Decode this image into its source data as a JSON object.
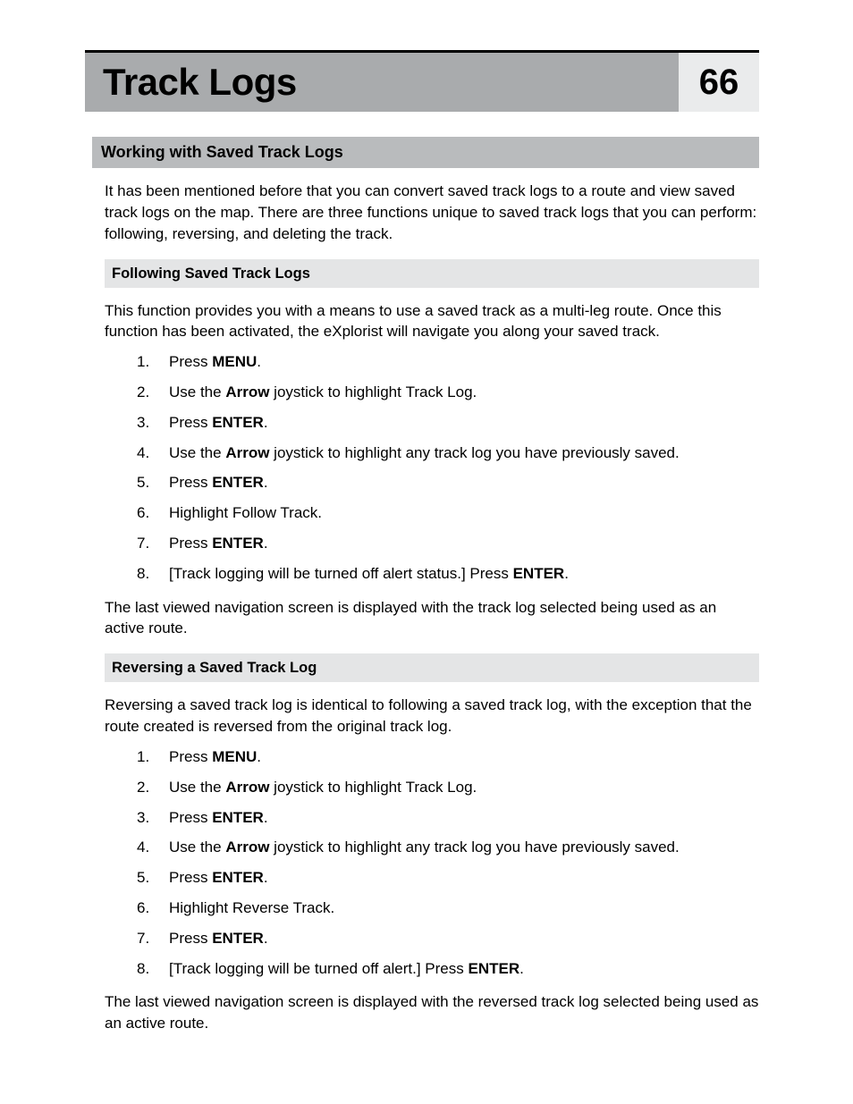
{
  "header": {
    "title": "Track Logs",
    "page": "66"
  },
  "section1": {
    "title": "Working with Saved Track Logs",
    "intro": "It has been mentioned before that you can convert saved track logs to a route and view saved track logs on the map.  There are three functions unique to saved track logs that you can perform: following, reversing, and deleting the track."
  },
  "subA": {
    "title": "Following Saved Track Logs",
    "intro": "This function provides you with a means to use a saved track as a multi-leg route.  Once this function has been activated, the eXplorist will navigate you along your saved track.",
    "steps": [
      {
        "n": "1.",
        "pre": "Press ",
        "b1": "MENU",
        "post": "."
      },
      {
        "n": "2.",
        "pre": "Use the ",
        "b1": "Arrow",
        "mid": " joystick to highlight ",
        "opt": "Track Log",
        "post": "."
      },
      {
        "n": "3.",
        "pre": "Press ",
        "b1": "ENTER",
        "post": "."
      },
      {
        "n": "4.",
        "pre": "Use the ",
        "b1": "Arrow",
        "mid": " joystick to highlight any track log you have previously saved.",
        "post": ""
      },
      {
        "n": "5.",
        "pre": "Press ",
        "b1": "ENTER",
        "post": "."
      },
      {
        "n": "6.",
        "pre": "Highlight ",
        "opt": "Follow Track",
        "post": "."
      },
      {
        "n": "7.",
        "pre": "Press ",
        "b1": "ENTER",
        "post": "."
      },
      {
        "n": "8.",
        "pre": "[Track logging will be turned off alert status.]  Press ",
        "b1": "ENTER",
        "post": "."
      }
    ],
    "outro": "The last viewed navigation screen is displayed with the track log selected being used as an active route."
  },
  "subB": {
    "title": "Reversing a Saved Track Log",
    "intro": "Reversing a saved track log is identical to following a saved track log, with the exception that the route created is reversed from the original track log.",
    "steps": [
      {
        "n": "1.",
        "pre": "Press ",
        "b1": "MENU",
        "post": "."
      },
      {
        "n": "2.",
        "pre": "Use the ",
        "b1": "Arrow",
        "mid": " joystick to highlight ",
        "opt": "Track Log",
        "post": "."
      },
      {
        "n": "3.",
        "pre": "Press ",
        "b1": "ENTER",
        "post": "."
      },
      {
        "n": "4.",
        "pre": "Use the ",
        "b1": "Arrow",
        "mid": " joystick to highlight any track log you have previously saved.",
        "post": ""
      },
      {
        "n": "5.",
        "pre": "Press ",
        "b1": "ENTER",
        "post": "."
      },
      {
        "n": "6.",
        "pre": "Highlight ",
        "opt": "Reverse Track",
        "post": "."
      },
      {
        "n": "7.",
        "pre": "Press ",
        "b1": "ENTER",
        "post": "."
      },
      {
        "n": "8.",
        "pre": "[Track logging will be turned off alert.]  Press ",
        "b1": "ENTER",
        "post": "."
      }
    ],
    "outro": "The last viewed navigation screen is displayed with the reversed track log selected being used as an active route."
  }
}
